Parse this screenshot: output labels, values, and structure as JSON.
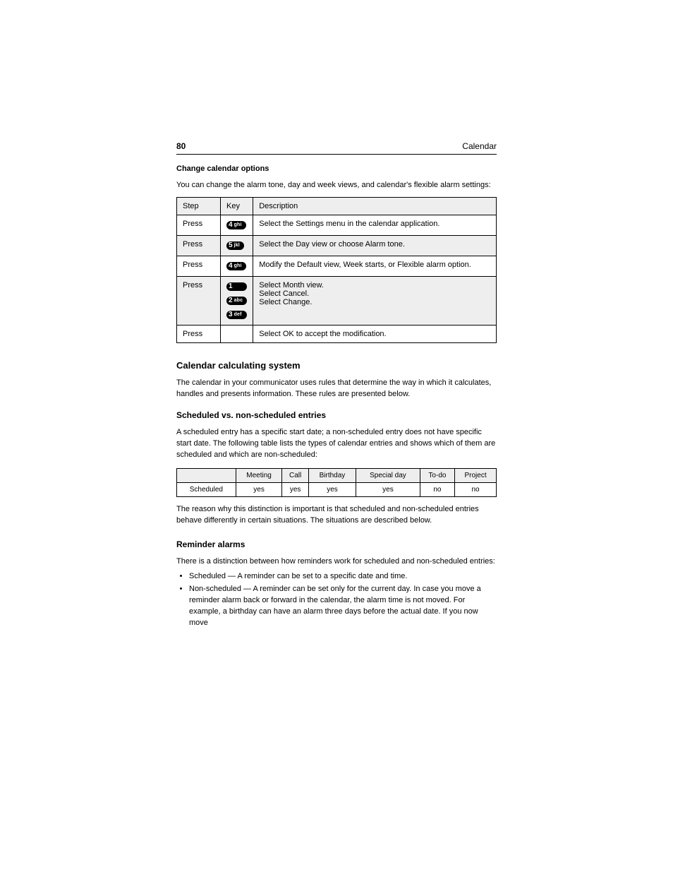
{
  "header": {
    "section": "80",
    "title": "Calendar"
  },
  "intro_subhead": "Change calendar options",
  "intro_para": "You can change the alarm tone, day and week views, and calendar's flexible alarm settings:",
  "menu": {
    "header_row": [
      "Step",
      "Key",
      "Description"
    ],
    "rows": [
      {
        "step": "Press",
        "key": {
          "num": "4",
          "let": "ghi"
        },
        "desc": "Select the Settings menu in the calendar application.",
        "shade": false
      },
      {
        "step": "Press",
        "key": {
          "num": "5",
          "let": "jkl"
        },
        "desc": "Select the Day view or choose Alarm tone.",
        "shade": true
      },
      {
        "step": "Press",
        "key": {
          "num": "4",
          "let": "ghi"
        },
        "desc": "Modify the Default view, Week starts, or Flexible alarm option.",
        "shade": false
      },
      {
        "step": "Press",
        "keys": [
          {
            "num": "1",
            "let": ""
          },
          {
            "num": "2",
            "let": "abc"
          },
          {
            "num": "3",
            "let": "def"
          }
        ],
        "desc_lines": [
          "Select Month view.",
          "Select Cancel.",
          "Select Change."
        ],
        "shade": true
      },
      {
        "step": "Press",
        "key": null,
        "desc": "Select OK to accept the modification.",
        "shade": false
      }
    ]
  },
  "calc_heading": "Calendar calculating system",
  "calc_para": "The calendar in your communicator uses rules that determine the way in which it calculates, handles and presents information. These rules are presented below.",
  "sched_heading": "Scheduled vs. non-scheduled entries",
  "sched_para": "A scheduled entry has a specific start date; a non-scheduled entry does not have specific start date. The following table lists the types of calendar entries and shows which of them are scheduled and which are non-scheduled:",
  "sched_table": {
    "headers": [
      "",
      "Meeting",
      "Call",
      "Birthday",
      "Special day",
      "To-do",
      "Project"
    ],
    "row_label": "Scheduled",
    "row": [
      "yes",
      "yes",
      "yes",
      "yes",
      "no",
      "no"
    ]
  },
  "sched_note": "The reason why this distinction is important is that scheduled and non-scheduled entries behave differently in certain situations. The situations are described below.",
  "reminder_heading": "Reminder alarms",
  "reminder_para": "There is a distinction between how reminders work for scheduled and non-scheduled entries:",
  "reminder_bullets": [
    "Scheduled — A reminder can be set to a specific date and time.",
    "Non-scheduled — A reminder can be set only for the current day. In case you move a reminder alarm back or forward in the calendar, the alarm time is not moved. For example, a birthday can have an alarm three days before the actual date. If you now move"
  ]
}
